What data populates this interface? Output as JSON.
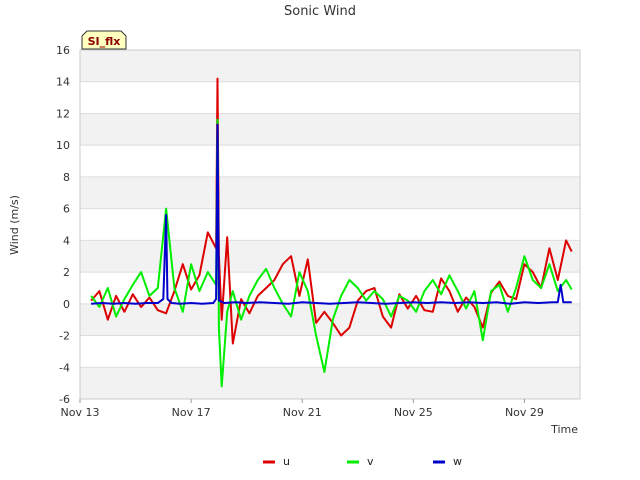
{
  "chart_data": {
    "type": "line",
    "title": "Sonic Wind",
    "xlabel": "Time",
    "ylabel": "Wind (m/s)",
    "badge": "SI_flx",
    "xlim": [
      "Nov 13",
      "Dec 1"
    ],
    "ylim": [
      -6,
      16
    ],
    "yticks": [
      -6,
      -4,
      -2,
      0,
      2,
      4,
      6,
      8,
      10,
      12,
      14,
      16
    ],
    "xticks": [
      {
        "label": "Nov 13",
        "day": 13
      },
      {
        "label": "Nov 17",
        "day": 17
      },
      {
        "label": "Nov 21",
        "day": 21
      },
      {
        "label": "Nov 25",
        "day": 25
      },
      {
        "label": "Nov 29",
        "day": 29
      }
    ],
    "grid": true,
    "legend_position": "bottom-center",
    "series": [
      {
        "name": "u",
        "color": "#dd0000",
        "x": [
          13.4,
          13.7,
          14.0,
          14.3,
          14.6,
          14.9,
          15.2,
          15.5,
          15.8,
          16.1,
          16.4,
          16.7,
          17.0,
          17.3,
          17.6,
          17.9,
          17.95,
          18.0,
          18.1,
          18.3,
          18.5,
          18.8,
          19.1,
          19.4,
          19.7,
          20.0,
          20.3,
          20.6,
          20.9,
          21.2,
          21.5,
          21.8,
          22.1,
          22.4,
          22.7,
          23.0,
          23.3,
          23.6,
          23.9,
          24.2,
          24.5,
          24.8,
          25.1,
          25.4,
          25.7,
          26.0,
          26.3,
          26.6,
          26.9,
          27.2,
          27.5,
          27.8,
          28.1,
          28.4,
          28.7,
          29.0,
          29.3,
          29.6,
          29.9,
          30.2,
          30.5,
          30.7
        ],
        "y": [
          0.2,
          0.8,
          -1.0,
          0.5,
          -0.5,
          0.6,
          -0.2,
          0.4,
          -0.4,
          -0.6,
          0.8,
          2.5,
          0.9,
          1.8,
          4.5,
          3.5,
          14.2,
          3.0,
          -1.0,
          4.2,
          -2.5,
          0.3,
          -0.6,
          0.5,
          1.0,
          1.5,
          2.5,
          3.0,
          0.5,
          2.8,
          -1.2,
          -0.5,
          -1.2,
          -2.0,
          -1.5,
          0.2,
          0.8,
          1.0,
          -0.8,
          -1.5,
          0.6,
          -0.3,
          0.5,
          -0.4,
          -0.5,
          1.6,
          0.8,
          -0.5,
          0.4,
          -0.2,
          -1.5,
          0.7,
          1.4,
          0.5,
          0.3,
          2.5,
          2.0,
          1.0,
          3.5,
          1.5,
          4.0,
          3.3
        ]
      },
      {
        "name": "v",
        "color": "#00ee00",
        "x": [
          13.4,
          13.7,
          14.0,
          14.3,
          14.6,
          14.9,
          15.2,
          15.5,
          15.8,
          16.1,
          16.4,
          16.7,
          17.0,
          17.3,
          17.6,
          17.9,
          17.95,
          18.0,
          18.1,
          18.3,
          18.5,
          18.8,
          19.1,
          19.4,
          19.7,
          20.0,
          20.3,
          20.6,
          20.9,
          21.2,
          21.5,
          21.8,
          22.1,
          22.4,
          22.7,
          23.0,
          23.3,
          23.6,
          23.9,
          24.2,
          24.5,
          24.8,
          25.1,
          25.4,
          25.7,
          26.0,
          26.3,
          26.6,
          26.9,
          27.2,
          27.5,
          27.8,
          28.1,
          28.4,
          28.7,
          29.0,
          29.3,
          29.6,
          29.9,
          30.2,
          30.5,
          30.7
        ],
        "y": [
          0.5,
          -0.2,
          1.0,
          -0.8,
          0.3,
          1.2,
          2.0,
          0.5,
          1.0,
          6.0,
          1.0,
          -0.5,
          2.5,
          0.8,
          2.0,
          1.2,
          11.6,
          -1.5,
          -5.2,
          -0.5,
          0.8,
          -1.0,
          0.5,
          1.5,
          2.2,
          1.0,
          0.0,
          -0.8,
          2.0,
          0.8,
          -2.0,
          -4.3,
          -1.0,
          0.5,
          1.5,
          1.0,
          0.2,
          0.8,
          0.3,
          -0.8,
          0.5,
          0.2,
          -0.5,
          0.8,
          1.5,
          0.6,
          1.8,
          0.8,
          -0.3,
          0.8,
          -2.3,
          0.8,
          1.2,
          -0.5,
          1.0,
          3.0,
          1.5,
          1.0,
          2.5,
          0.8,
          1.5,
          0.9
        ]
      },
      {
        "name": "w",
        "color": "#0000cc",
        "x": [
          13.4,
          13.8,
          14.2,
          14.6,
          15.0,
          15.4,
          15.8,
          16.0,
          16.1,
          16.15,
          16.3,
          16.6,
          17.0,
          17.4,
          17.8,
          17.9,
          17.95,
          18.0,
          18.2,
          18.6,
          19.0,
          19.5,
          20.0,
          20.5,
          21.0,
          21.5,
          22.0,
          22.5,
          23.0,
          23.5,
          24.0,
          24.5,
          25.0,
          25.5,
          26.0,
          26.5,
          27.0,
          27.5,
          28.0,
          28.5,
          29.0,
          29.5,
          30.0,
          30.2,
          30.3,
          30.4,
          30.7
        ],
        "y": [
          0.0,
          0.05,
          0.0,
          0.05,
          0.0,
          0.05,
          0.05,
          0.3,
          5.6,
          0.3,
          0.05,
          0.0,
          0.05,
          0.0,
          0.05,
          0.3,
          11.3,
          0.2,
          0.05,
          0.1,
          0.05,
          0.1,
          0.05,
          0.0,
          0.1,
          0.05,
          0.0,
          0.05,
          0.1,
          0.05,
          0.0,
          0.05,
          0.1,
          0.05,
          0.1,
          0.05,
          0.1,
          0.05,
          0.1,
          0.0,
          0.1,
          0.05,
          0.1,
          0.1,
          1.2,
          0.1,
          0.1
        ]
      }
    ]
  }
}
